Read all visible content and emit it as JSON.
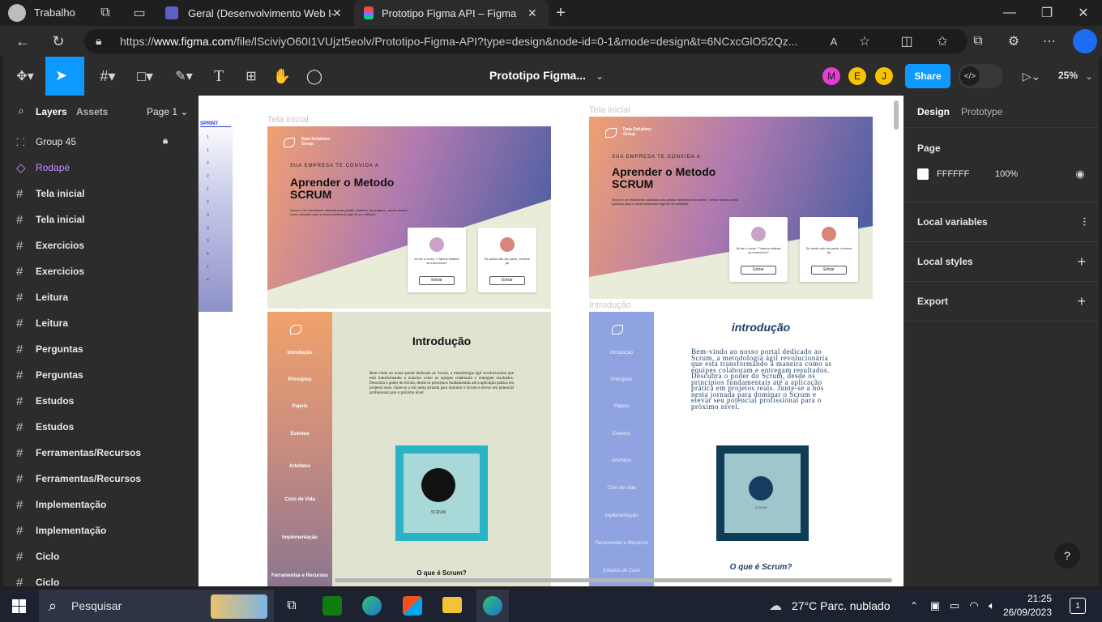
{
  "browser": {
    "profile_label": "Trabalho",
    "tabs": [
      {
        "label": "Geral (Desenvolvimento Web I-A"
      },
      {
        "label": "Prototipo Figma API – Figma"
      }
    ],
    "url_prefix": "https://",
    "url_host": "www.figma.com",
    "url_rest": "/file/lSciviyO60I1VUjzt5eolv/Prototipo-Figma-API?type=design&node-id=0-1&mode=design&t=6NCxcGlO52Qz..."
  },
  "figma": {
    "file_title": "Prototipo Figma...",
    "avatars": [
      {
        "initial": "M",
        "color": "#e83bd4"
      },
      {
        "initial": "E",
        "color": "#f5c400"
      },
      {
        "initial": "J",
        "color": "#f5c400"
      }
    ],
    "share_label": "Share",
    "zoom": "25%",
    "accent": "#0d99ff"
  },
  "left_panel": {
    "tab_layers": "Layers",
    "tab_assets": "Assets",
    "page": "Page 1",
    "layers": [
      {
        "label": "Group 45",
        "icon": "group-icon"
      },
      {
        "label": "Rodapé",
        "icon": "component-icon"
      },
      {
        "label": "Tela inicial",
        "icon": "frame-icon"
      },
      {
        "label": "Tela inicial",
        "icon": "frame-icon"
      },
      {
        "label": "Exercicios",
        "icon": "frame-icon"
      },
      {
        "label": "Exercicios",
        "icon": "frame-icon"
      },
      {
        "label": "Leitura",
        "icon": "frame-icon"
      },
      {
        "label": "Leitura",
        "icon": "frame-icon"
      },
      {
        "label": "Perguntas",
        "icon": "frame-icon"
      },
      {
        "label": "Perguntas",
        "icon": "frame-icon"
      },
      {
        "label": "Estudos",
        "icon": "frame-icon"
      },
      {
        "label": "Estudos",
        "icon": "frame-icon"
      },
      {
        "label": "Ferramentas/Recursos",
        "icon": "frame-icon"
      },
      {
        "label": "Ferramentas/Recursos",
        "icon": "frame-icon"
      },
      {
        "label": "Implementação",
        "icon": "frame-icon"
      },
      {
        "label": "Implementação",
        "icon": "frame-icon"
      },
      {
        "label": "Ciclo",
        "icon": "frame-icon"
      },
      {
        "label": "Ciclo",
        "icon": "frame-icon"
      }
    ]
  },
  "canvas": {
    "sprint_label": "SPRINT",
    "sprint_numbers": [
      "1",
      "1",
      "2",
      "2",
      "1",
      "2",
      "3",
      "3",
      "3",
      "4",
      "1",
      "4"
    ],
    "frame_labels": {
      "tela1": "Tela inicial",
      "tela2": "Tela inicial",
      "intro1": "Introdução",
      "intro2": "Introdução"
    },
    "hero": {
      "logo_text": "Data Solutions Group",
      "kicker": "SUA EMPRESA TE CONVIDA A",
      "title": "Aprender o Metodo SCRUM",
      "body": "Scrum é um framework utilizado para gestão dinâmica de projetos , sendo muitos vezes aplicado para o desenvolvimento ágil de um software.",
      "card1_text": "Já fez o curso ? Vamos realizar os exercícios?",
      "card2_text": "Se ainda não faz parte, comece já!",
      "button": "Entrar"
    },
    "intro_left": {
      "menu": [
        "Introdução",
        "Princípios",
        "Papeis",
        "Eventos",
        "Artefatos",
        "Ciclo de Vida",
        "Implementação",
        "Ferramentas e Recursos"
      ],
      "title": "Introdução",
      "body": "Bem-vindo ao nosso portal dedicado ao Scrum, a metodologia ágil revolucionária que está transformando a maneira como as equipes colaboram e entregam resultados. Descubra o poder do Scrum, desde os princípios fundamentais até a aplicação prática em projetos reais. Junte-se a nós nesta jornada para dominar o Scrum e elevar seu potencial profissional para o próximo nível.",
      "scrum_label": "SCRUM",
      "question": "O que é Scrum?"
    },
    "intro_right": {
      "menu": [
        "Introdução",
        "Princípios",
        "Papeis",
        "Eventos",
        "Artefatos",
        "Ciclo de Vida",
        "Implementação",
        "Ferramentas e Recursos",
        "Estudos de Caso"
      ],
      "title": "introdução",
      "body": "Bem-vindo ao nosso portal dedicado ao Scrum, a metodologia ágil revolucionária que está transformando a maneira como as equipes colaboram e entregam resultados. Descubra o poder do Scrum, desde os princípios fundamentais até a aplicação prática em projetos reais. Junte-se a nós nesta jornada para dominar o Scrum e elevar seu potencial profissional para o próximo nível.",
      "scrum_label": "SCRUM",
      "question": "O que é Scrum?"
    }
  },
  "right_panel": {
    "tab_design": "Design",
    "tab_prototype": "Prototype",
    "page_heading": "Page",
    "page_color": "FFFFFF",
    "page_opacity": "100%",
    "sections": [
      "Local variables",
      "Local styles",
      "Export"
    ],
    "help": "?"
  },
  "taskbar": {
    "search_placeholder": "Pesquisar",
    "weather": "27°C  Parc. nublado",
    "time": "21:25",
    "date": "26/09/2023",
    "notifications": "1"
  }
}
